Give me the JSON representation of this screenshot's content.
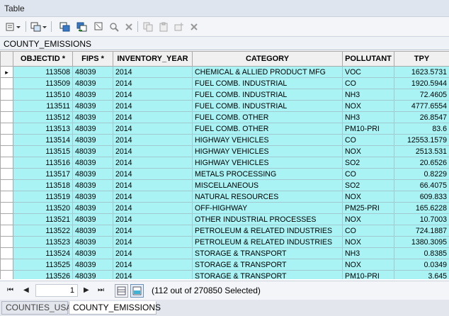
{
  "window": {
    "title": "Table"
  },
  "table_name": "COUNTY_EMISSIONS",
  "columns": [
    "OBJECTID *",
    "FIPS *",
    "INVENTORY_YEAR",
    "CATEGORY",
    "POLLUTANT",
    "TPY"
  ],
  "rows": [
    {
      "objectid": "113508",
      "fips": "48039",
      "year": "2014",
      "category": "CHEMICAL & ALLIED PRODUCT MFG",
      "pollutant": "VOC",
      "tpy": "1623.5731"
    },
    {
      "objectid": "113509",
      "fips": "48039",
      "year": "2014",
      "category": "FUEL COMB. INDUSTRIAL",
      "pollutant": "CO",
      "tpy": "1920.5944"
    },
    {
      "objectid": "113510",
      "fips": "48039",
      "year": "2014",
      "category": "FUEL COMB. INDUSTRIAL",
      "pollutant": "NH3",
      "tpy": "72.4605"
    },
    {
      "objectid": "113511",
      "fips": "48039",
      "year": "2014",
      "category": "FUEL COMB. INDUSTRIAL",
      "pollutant": "NOX",
      "tpy": "4777.6554"
    },
    {
      "objectid": "113512",
      "fips": "48039",
      "year": "2014",
      "category": "FUEL COMB. OTHER",
      "pollutant": "NH3",
      "tpy": "26.8547"
    },
    {
      "objectid": "113513",
      "fips": "48039",
      "year": "2014",
      "category": "FUEL COMB. OTHER",
      "pollutant": "PM10-PRI",
      "tpy": "83.6"
    },
    {
      "objectid": "113514",
      "fips": "48039",
      "year": "2014",
      "category": "HIGHWAY VEHICLES",
      "pollutant": "CO",
      "tpy": "12553.1579"
    },
    {
      "objectid": "113515",
      "fips": "48039",
      "year": "2014",
      "category": "HIGHWAY VEHICLES",
      "pollutant": "NOX",
      "tpy": "2513.531"
    },
    {
      "objectid": "113516",
      "fips": "48039",
      "year": "2014",
      "category": "HIGHWAY VEHICLES",
      "pollutant": "SO2",
      "tpy": "20.6526"
    },
    {
      "objectid": "113517",
      "fips": "48039",
      "year": "2014",
      "category": "METALS PROCESSING",
      "pollutant": "CO",
      "tpy": "0.8229"
    },
    {
      "objectid": "113518",
      "fips": "48039",
      "year": "2014",
      "category": "MISCELLANEOUS",
      "pollutant": "SO2",
      "tpy": "66.4075"
    },
    {
      "objectid": "113519",
      "fips": "48039",
      "year": "2014",
      "category": "NATURAL RESOURCES",
      "pollutant": "NOX",
      "tpy": "609.833"
    },
    {
      "objectid": "113520",
      "fips": "48039",
      "year": "2014",
      "category": "OFF-HIGHWAY",
      "pollutant": "PM25-PRI",
      "tpy": "165.6228"
    },
    {
      "objectid": "113521",
      "fips": "48039",
      "year": "2014",
      "category": "OTHER INDUSTRIAL PROCESSES",
      "pollutant": "NOX",
      "tpy": "10.7003"
    },
    {
      "objectid": "113522",
      "fips": "48039",
      "year": "2014",
      "category": "PETROLEUM & RELATED INDUSTRIES",
      "pollutant": "CO",
      "tpy": "724.1887"
    },
    {
      "objectid": "113523",
      "fips": "48039",
      "year": "2014",
      "category": "PETROLEUM & RELATED INDUSTRIES",
      "pollutant": "NOX",
      "tpy": "1380.3095"
    },
    {
      "objectid": "113524",
      "fips": "48039",
      "year": "2014",
      "category": "STORAGE & TRANSPORT",
      "pollutant": "NH3",
      "tpy": "0.8385"
    },
    {
      "objectid": "113525",
      "fips": "48039",
      "year": "2014",
      "category": "STORAGE & TRANSPORT",
      "pollutant": "NOX",
      "tpy": "0.0349"
    },
    {
      "objectid": "113526",
      "fips": "48039",
      "year": "2014",
      "category": "STORAGE & TRANSPORT",
      "pollutant": "PM10-PRI",
      "tpy": "3.645"
    }
  ],
  "current_row_marker": "▸",
  "nav": {
    "first": "⏮",
    "prev": "◀",
    "page": "1",
    "next": "▶",
    "last": "⏭"
  },
  "status": "(112 out of 270850 Selected)",
  "tabs": [
    "COUNTIES_USA",
    "COUNTY_EMISSIONS"
  ],
  "colors": {
    "selected_row": "#a9f3f5",
    "title_bar": "#dfe5ee",
    "toolbar": "#f3f5f8"
  },
  "icons": [
    "table-options-icon",
    "related-tables-icon",
    "select-by-attributes-icon",
    "switch-selection-icon",
    "clear-selection-icon",
    "zoom-to-selected-icon",
    "delete-selected-icon",
    "copy-icon",
    "paste-icon",
    "add-field-icon",
    "close-icon"
  ]
}
